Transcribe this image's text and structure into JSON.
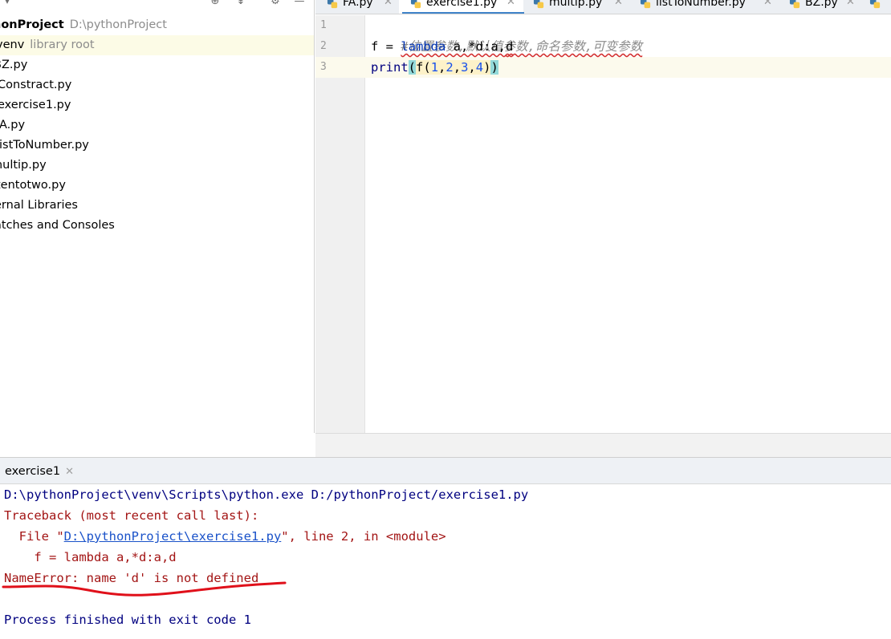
{
  "project_tree": {
    "items": [
      {
        "label": "honProject",
        "hint": "D:\\pythonProject",
        "bold": true
      },
      {
        "label": "venv",
        "hint": "library root",
        "selected": true
      },
      {
        "label": "BZ.py"
      },
      {
        "label": "Constract.py"
      },
      {
        "label": "exercise1.py"
      },
      {
        "label": "FA.py"
      },
      {
        "label": "listToNumber.py"
      },
      {
        "label": "multip.py"
      },
      {
        "label": "tentotwo.py"
      },
      {
        "label": "ernal Libraries"
      },
      {
        "label": "atches and Consoles"
      }
    ]
  },
  "tabs": [
    {
      "label": "FA.py",
      "active": false
    },
    {
      "label": "exercise1.py",
      "active": true
    },
    {
      "label": "multip.py",
      "active": false
    },
    {
      "label": "listToNumber.py",
      "active": false
    },
    {
      "label": "BZ.py",
      "active": false
    }
  ],
  "editor": {
    "line_numbers": [
      "1",
      "2",
      "3"
    ],
    "lines": {
      "l1_comment": "#位置参数,默认值参数,命名参数,可变参数",
      "l2_pre": "f = ",
      "l2_kw": "lambda",
      "l2_mid": " a,*d:a,",
      "l2_warn": "d",
      "l3_builtin": "print",
      "l3_open": "(",
      "l3_f": "f(",
      "l3_n1": "1",
      "l3_c1": ",",
      "l3_n2": "2",
      "l3_c2": ",",
      "l3_n3": "3",
      "l3_c3": ",",
      "l3_n4": "4",
      "l3_inner_close": ")",
      "l3_close": ")"
    }
  },
  "run_window": {
    "tab_label": "exercise1",
    "console": {
      "cmd": "D:\\pythonProject\\venv\\Scripts\\python.exe D:/pythonProject/exercise1.py",
      "traceback_header": "Traceback (most recent call last):",
      "file_prefix": "  File \"",
      "file_link": "D:\\pythonProject\\exercise1.py",
      "file_suffix": "\", line 2, in <module>",
      "code_line": "    f = lambda a,*d:a,d",
      "error": "NameError: name 'd' is not defined",
      "exit": "Process finished with exit code 1"
    }
  },
  "colors": {
    "selected_row": "#fcfbe6",
    "active_tab_underline": "#4083c9",
    "annotation_red": "#e0101a"
  }
}
